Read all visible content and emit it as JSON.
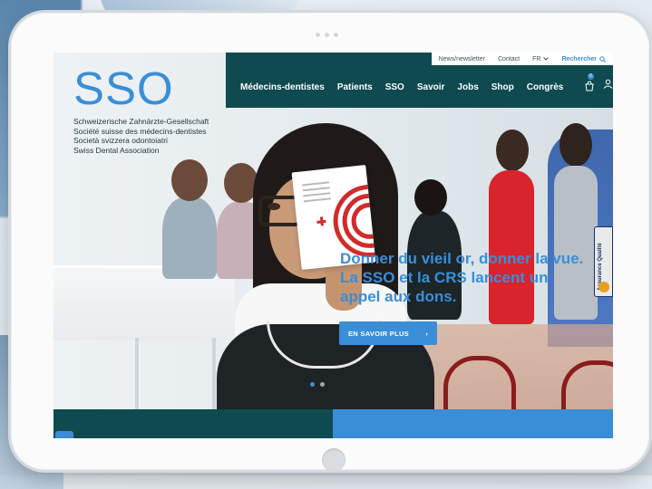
{
  "site": {
    "logo": "SSO",
    "tagline_lines": [
      "Schweizerische Zahnärzte-Gesellschaft",
      "Société suisse des médecins-dentistes",
      "Società svizzera odontoiatri",
      "Swiss Dental Association"
    ]
  },
  "utility_nav": {
    "newsletter": "News/newsletter",
    "contact": "Contact",
    "language": "FR",
    "search": "Rechercher"
  },
  "main_nav": [
    {
      "label": "Médecins-dentistes"
    },
    {
      "label": "Patients"
    },
    {
      "label": "SSO"
    },
    {
      "label": "Savoir"
    },
    {
      "label": "Jobs"
    },
    {
      "label": "Shop"
    },
    {
      "label": "Congrès"
    }
  ],
  "cart": {
    "count": "0"
  },
  "hero": {
    "headline_lines": [
      "Donner du vieil or, donner la vue.",
      "La SSO et la CRS lancent un",
      "appel aux dons."
    ],
    "cta_label": "EN SAVOIR PLUS",
    "cta_arrow": "›",
    "slide_count": 2,
    "active_slide": 1
  },
  "side_widget": {
    "label": "Assurance Qualité"
  },
  "icons": {
    "search": "search-icon",
    "cart": "shopping-bag-icon",
    "user": "user-icon",
    "chevron": "chevron-down-icon"
  },
  "colors": {
    "brand_blue": "#3a8ed8",
    "nav_teal": "#0e4a4f",
    "text_dark": "#243841"
  }
}
